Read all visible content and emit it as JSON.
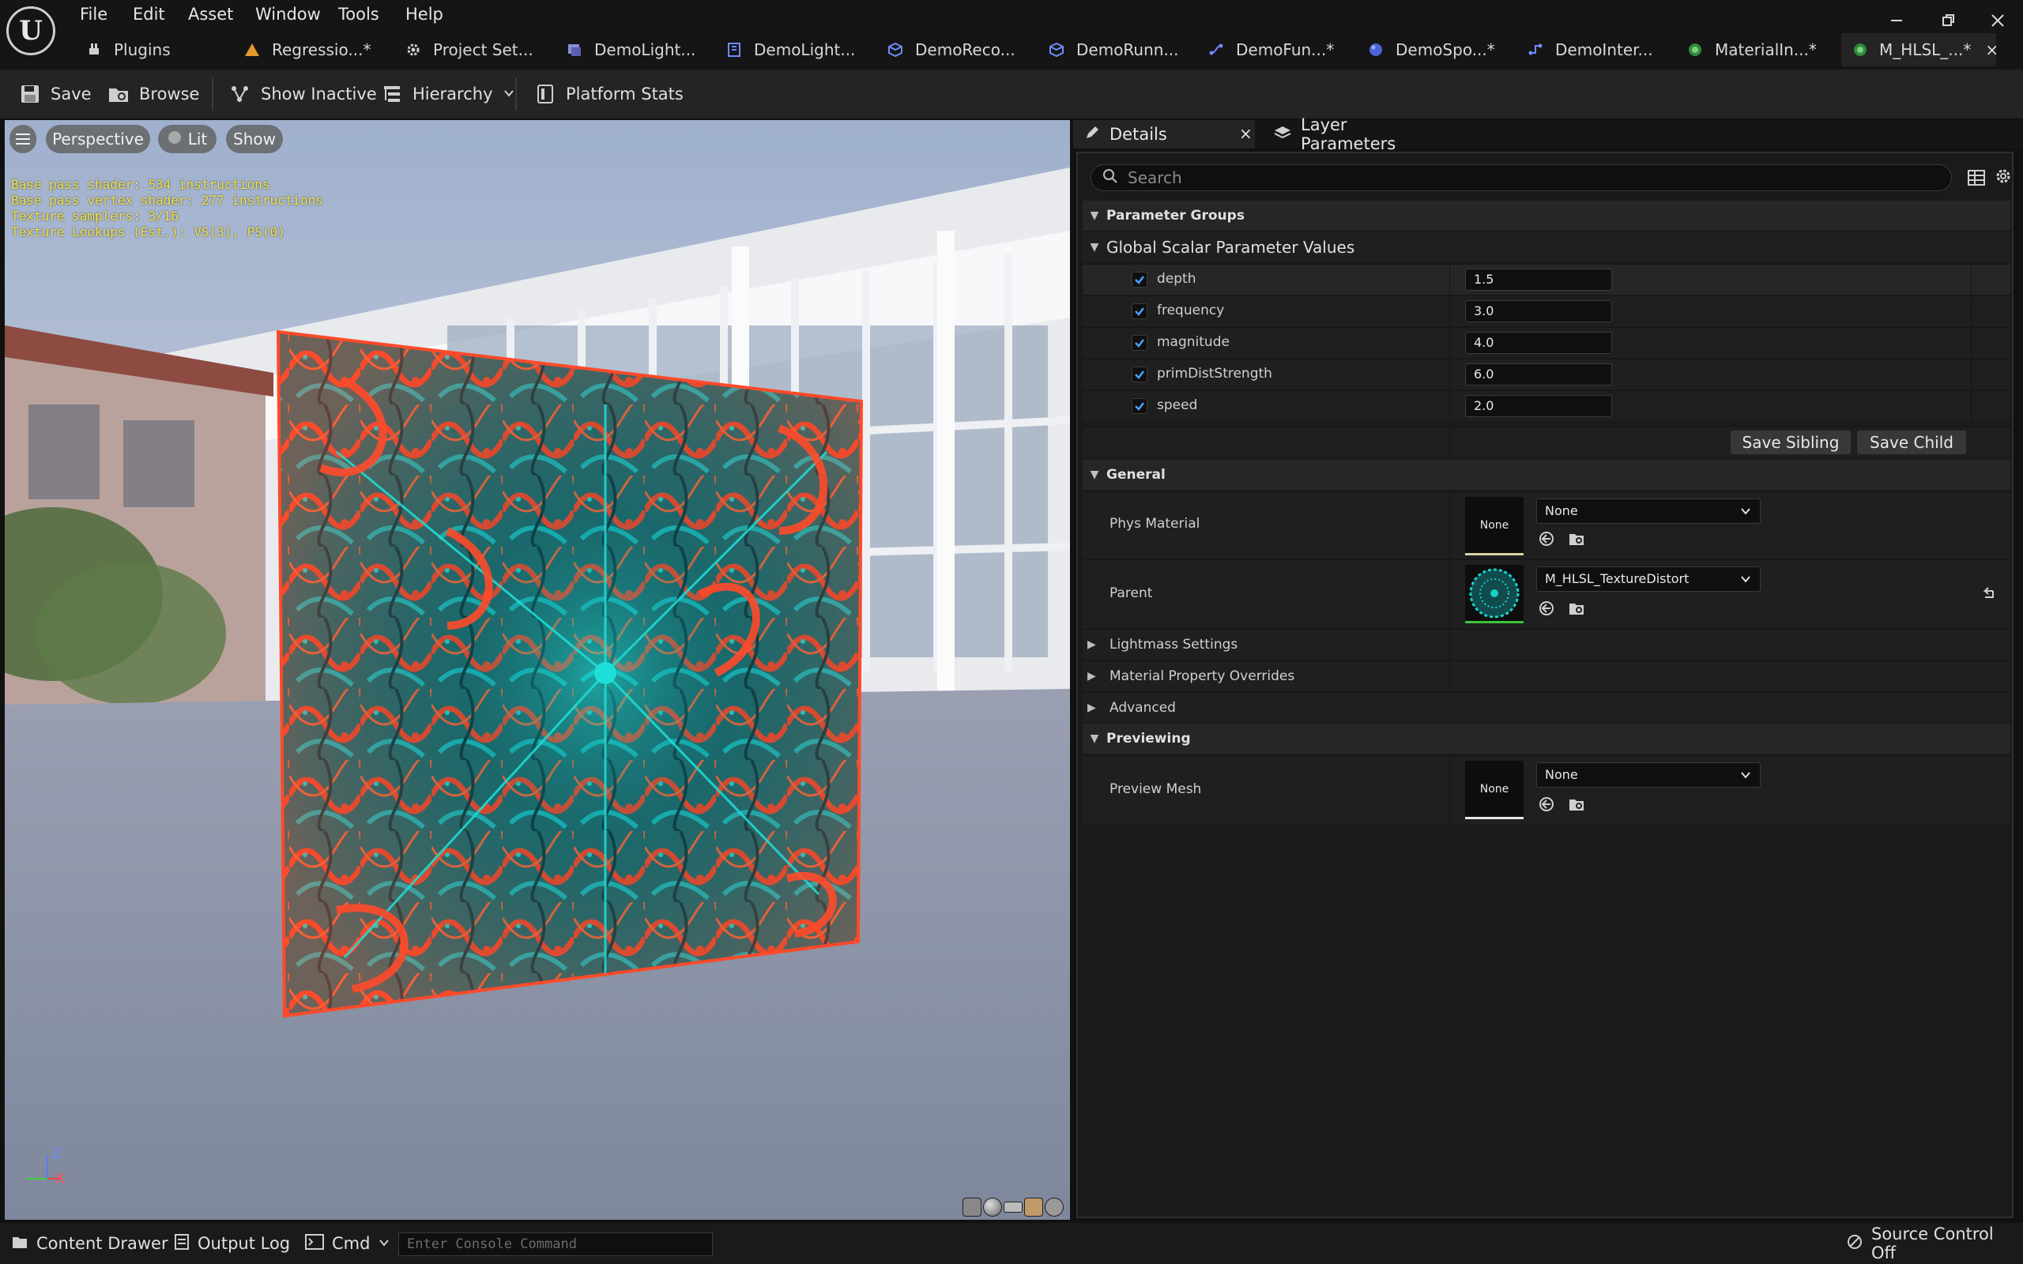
{
  "menu": {
    "items": [
      "File",
      "Edit",
      "Asset",
      "Window",
      "Tools",
      "Help"
    ]
  },
  "tabs": [
    {
      "label": "Plugins",
      "icon": "plug-icon"
    },
    {
      "label": "Regressio...*",
      "icon": "warning-icon"
    },
    {
      "label": "Project Set...",
      "icon": "gear-icon"
    },
    {
      "label": "DemoLight...",
      "icon": "level-icon"
    },
    {
      "label": "DemoLight...",
      "icon": "blueprint-icon"
    },
    {
      "label": "DemoReco...",
      "icon": "cube-icon"
    },
    {
      "label": "DemoRunn...",
      "icon": "cube-icon"
    },
    {
      "label": "DemoFun...*",
      "icon": "function-icon"
    },
    {
      "label": "DemoSpo...*",
      "icon": "sphere-icon"
    },
    {
      "label": "DemoInter...",
      "icon": "interface-icon"
    },
    {
      "label": "MaterialIn...*",
      "icon": "material-icon"
    },
    {
      "label": "M_HLSL_...*",
      "icon": "material-icon",
      "close": "×"
    }
  ],
  "toolbar": {
    "save": "Save",
    "browse": "Browse",
    "show_inactive": "Show Inactive",
    "hierarchy": "Hierarchy",
    "platform_stats": "Platform Stats"
  },
  "viewport": {
    "perspective": "Perspective",
    "lit": "Lit",
    "show": "Show",
    "stats": [
      "Base pass shader: 534 instructions",
      "Base pass vertex shader: 277 instructions",
      "Texture samplers: 3/16",
      "Texture Lookups (Est.): VS(3), PS(0)"
    ],
    "axis_z": "Z",
    "axis_x": "X"
  },
  "details": {
    "tab_details": "Details",
    "tab_layer_params": "Layer Parameters",
    "search_placeholder": "Search",
    "parameter_groups": "Parameter Groups",
    "global_scalar": "Global Scalar Parameter Values",
    "params": [
      {
        "name": "depth",
        "value": "1.5",
        "checked": true
      },
      {
        "name": "frequency",
        "value": "3.0",
        "checked": true
      },
      {
        "name": "magnitude",
        "value": "4.0",
        "checked": true
      },
      {
        "name": "primDistStrength",
        "value": "6.0",
        "checked": true
      },
      {
        "name": "speed",
        "value": "2.0",
        "checked": true
      }
    ],
    "save_sibling": "Save Sibling",
    "save_child": "Save Child",
    "general": "General",
    "phys_material_label": "Phys Material",
    "phys_material_thumb": "None",
    "phys_material_value": "None",
    "parent_label": "Parent",
    "parent_value": "M_HLSL_TextureDistort",
    "lightmass": "Lightmass Settings",
    "material_overrides": "Material Property Overrides",
    "advanced": "Advanced",
    "previewing": "Previewing",
    "preview_mesh_label": "Preview Mesh",
    "preview_mesh_thumb": "None",
    "preview_mesh_value": "None"
  },
  "statusbar": {
    "content_drawer": "Content Drawer",
    "output_log": "Output Log",
    "cmd": "Cmd",
    "console_placeholder": "Enter Console Command",
    "source_control": "Source Control Off"
  },
  "colors": {
    "accent_blue": "#2f6fd6",
    "check_blue": "#4aa3ff",
    "pattern_red": "#ff4a2a",
    "pattern_teal": "#1aa6a8",
    "parent_thumb_green": "#3ec23a"
  }
}
